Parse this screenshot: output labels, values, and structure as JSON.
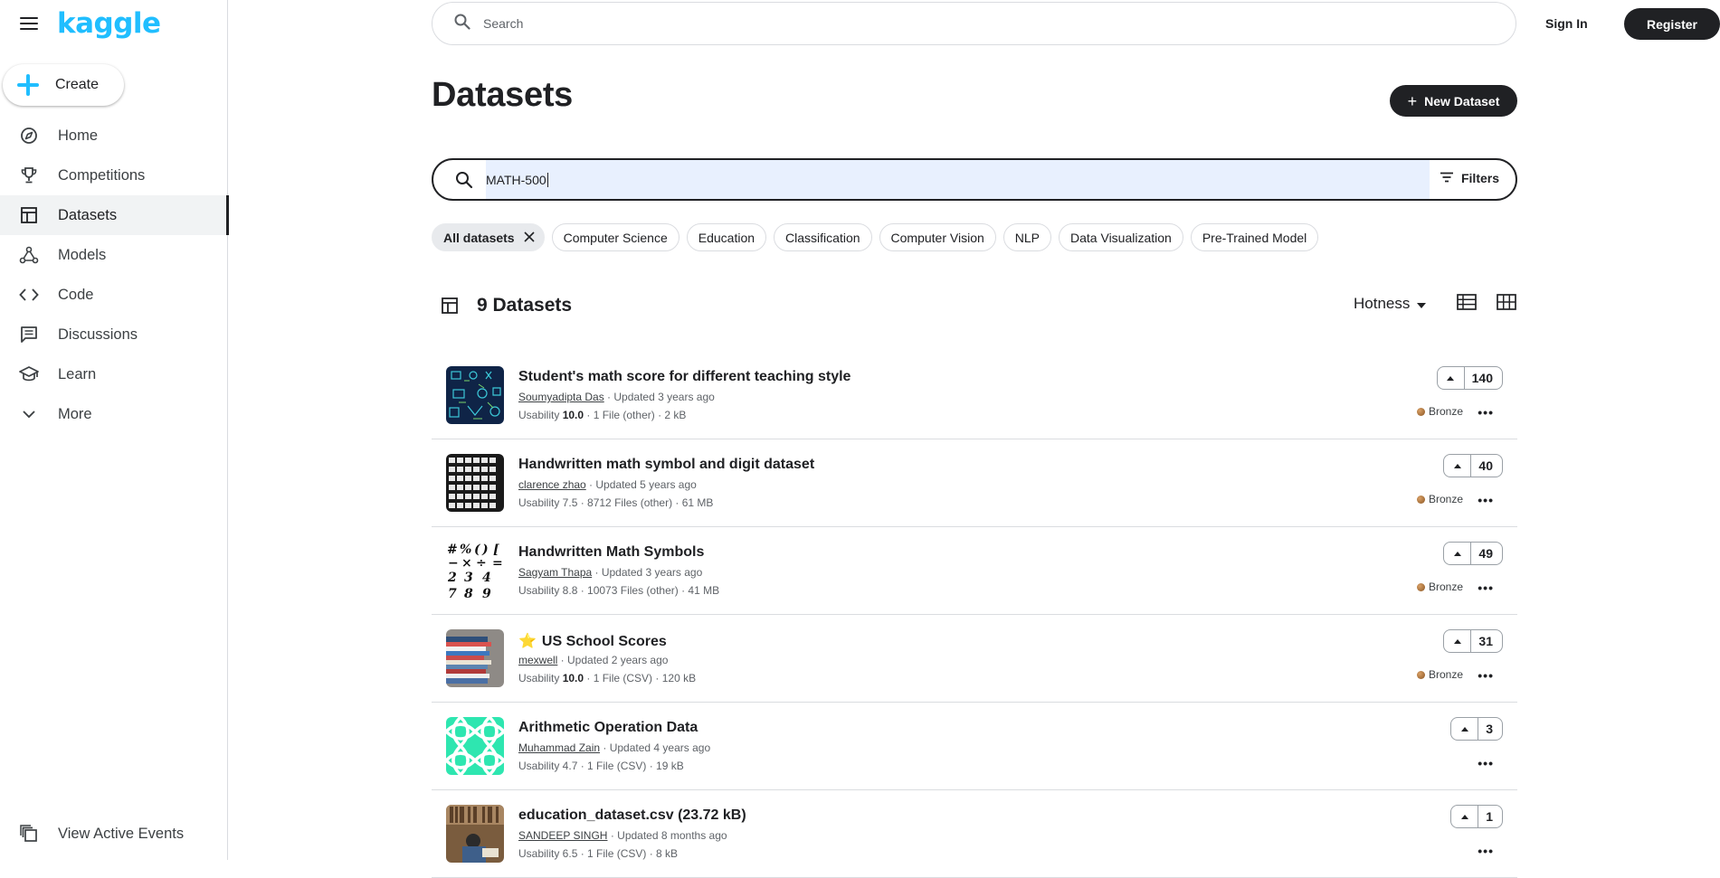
{
  "brand": {
    "logo_text": "kaggle"
  },
  "sidebar": {
    "create_label": "Create",
    "items": [
      {
        "label": "Home",
        "icon": "compass-icon"
      },
      {
        "label": "Competitions",
        "icon": "trophy-icon"
      },
      {
        "label": "Datasets",
        "icon": "table-icon",
        "active": true
      },
      {
        "label": "Models",
        "icon": "models-icon"
      },
      {
        "label": "Code",
        "icon": "code-icon"
      },
      {
        "label": "Discussions",
        "icon": "comments-icon"
      },
      {
        "label": "Learn",
        "icon": "graduation-cap-icon"
      },
      {
        "label": "More",
        "icon": "chevron-down-icon"
      }
    ],
    "bottom_label": "View Active Events"
  },
  "header": {
    "search_placeholder": "Search",
    "sign_in": "Sign In",
    "register": "Register"
  },
  "page": {
    "title": "Datasets",
    "new_dataset": "New Dataset",
    "search_value": "MATH-500",
    "filters_label": "Filters",
    "chips": [
      {
        "label": "All datasets",
        "selected": true
      },
      {
        "label": "Computer Science"
      },
      {
        "label": "Education"
      },
      {
        "label": "Classification"
      },
      {
        "label": "Computer Vision"
      },
      {
        "label": "NLP"
      },
      {
        "label": "Data Visualization"
      },
      {
        "label": "Pre-Trained Model"
      }
    ],
    "count_label": "9 Datasets",
    "sort_label": "Hotness"
  },
  "datasets": [
    {
      "title": "Student's math score for different teaching style",
      "author": "Soumyadipta Das",
      "updated": " · Updated 3 years ago",
      "usability_label": "Usability ",
      "usability": "10.0",
      "details": " · 1 File (other) · 2 kB",
      "votes": "140",
      "medal": "Bronze"
    },
    {
      "title": "Handwritten math symbol and digit dataset",
      "author": "clarence zhao",
      "updated": " · Updated 5 years ago",
      "usability_label": "Usability 7.5",
      "usability": "",
      "details": " · 8712 Files (other) · 61 MB",
      "votes": "40",
      "medal": "Bronze"
    },
    {
      "title": "Handwritten Math Symbols",
      "author": "Sagyam Thapa",
      "updated": " · Updated 3 years ago",
      "usability_label": "Usability 8.8",
      "usability": "",
      "details": " · 10073 Files (other) · 41 MB",
      "votes": "49",
      "medal": "Bronze"
    },
    {
      "title": "US School Scores",
      "title_emoji": "⭐",
      "author": "mexwell",
      "updated": " · Updated 2 years ago",
      "usability_label": "Usability ",
      "usability": "10.0",
      "details": " · 1 File (CSV) · 120 kB",
      "votes": "31",
      "medal": "Bronze"
    },
    {
      "title": "Arithmetic Operation Data",
      "author": "Muhammad Zain",
      "updated": " · Updated 4 years ago",
      "usability_label": "Usability 4.7",
      "usability": "",
      "details": " · 1 File (CSV) · 19 kB",
      "votes": "3",
      "medal": ""
    },
    {
      "title": "education_dataset.csv (23.72 kB)",
      "author": "SANDEEP SINGH",
      "updated": " · Updated 8 months ago",
      "usability_label": "Usability 6.5",
      "usability": "",
      "details": " · 1 File (CSV) · 8 kB",
      "votes": "1",
      "medal": ""
    }
  ],
  "more_glyph": "•••",
  "colors": {
    "accent": "#20beff",
    "dark": "#202124",
    "selected_input": "#e8f0fe"
  }
}
